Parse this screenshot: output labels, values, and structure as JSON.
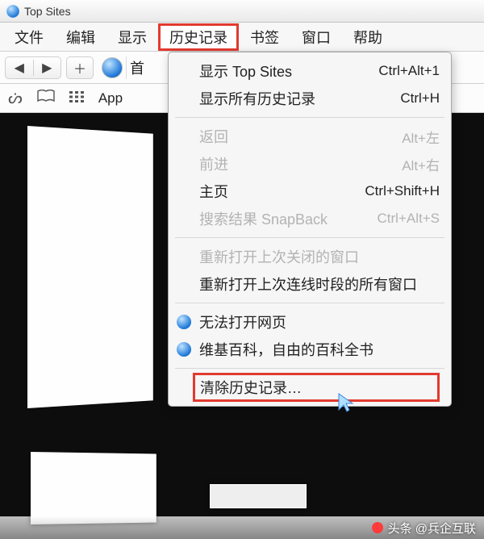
{
  "titlebar": {
    "title": "Top Sites"
  },
  "menubar": {
    "file": "文件",
    "edit": "编辑",
    "view": "显示",
    "history": "历史记录",
    "bookmarks": "书签",
    "window": "窗口",
    "help": "帮助"
  },
  "toolbar": {
    "back": "◀",
    "forward": "▶",
    "add": "＋",
    "address_prefix": "首"
  },
  "bookmarkbar": {
    "glasses": "👓",
    "book": "▭",
    "grid": "⠿",
    "apple_label": "App"
  },
  "dropdown": {
    "show_top_sites": {
      "label": "显示 Top Sites",
      "accel": "Ctrl+Alt+1"
    },
    "show_all_history": {
      "label": "显示所有历史记录",
      "accel": "Ctrl+H"
    },
    "back": {
      "label": "返回",
      "accel": "Alt+左"
    },
    "forward": {
      "label": "前进",
      "accel": "Alt+右"
    },
    "home": {
      "label": "主页",
      "accel": "Ctrl+Shift+H"
    },
    "snapback": {
      "label": "搜索结果 SnapBack",
      "accel": "Ctrl+Alt+S"
    },
    "reopen_last_window": {
      "label": "重新打开上次关闭的窗口"
    },
    "reopen_last_session": {
      "label": "重新打开上次连线时段的所有窗口"
    },
    "recent_fail": {
      "label": "无法打开网页"
    },
    "recent_wiki": {
      "label": "维基百科，自由的百科全书"
    },
    "clear_history": {
      "label": "清除历史记录…"
    }
  },
  "watermark": {
    "text": "头条 @兵企互联"
  }
}
